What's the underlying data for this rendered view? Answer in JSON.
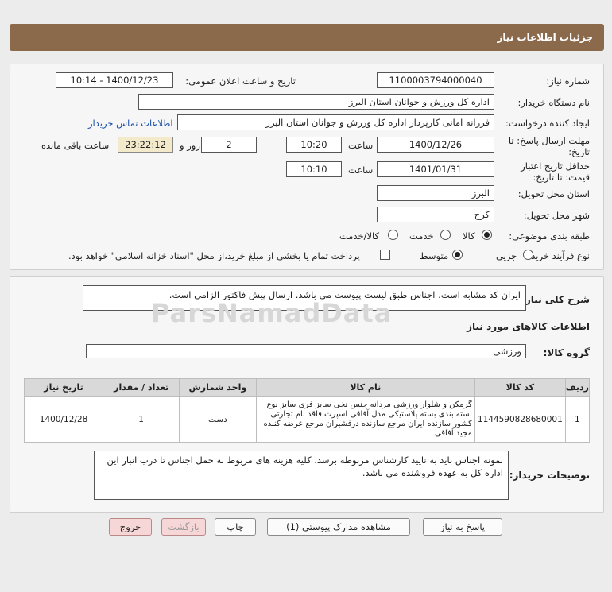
{
  "header": {
    "title": "جزئیات اطلاعات نیاز"
  },
  "form": {
    "need_number_label": "شماره نیاز:",
    "need_number": "1100003794000040",
    "announce_label": "تاریخ و ساعت اعلان عمومی:",
    "announce_value": "1400/12/23 - 10:14",
    "buyer_org_label": "نام دستگاه خریدار:",
    "buyer_org": "اداره کل ورزش و جوانان استان البرز",
    "requester_label": "ایجاد کننده درخواست:",
    "requester": "فرزانه امانی کارپرداز اداره کل ورزش و جوانان استان البرز",
    "contact_link": "اطلاعات تماس خریدار",
    "deadline_label_1": "مهلت ارسال پاسخ: تا",
    "deadline_label_2": "تاریخ:",
    "deadline_date": "1400/12/26",
    "time_label": "ساعت",
    "deadline_time": "10:20",
    "days_value": "2",
    "days_label": "روز و",
    "remaining_time": "23:22:12",
    "remaining_label": "ساعت باقی مانده",
    "validity_label_1": "حداقل تاریخ اعتبار",
    "validity_label_2": "قیمت: تا تاریخ:",
    "validity_date": "1401/01/31",
    "validity_time": "10:10",
    "province_label": "استان محل تحویل:",
    "province": "البرز",
    "city_label": "شهر محل تحویل:",
    "city": "کرج",
    "category_label": "طبقه بندی موضوعی:",
    "category_options": [
      "کالا",
      "خدمت",
      "کالا/خدمت"
    ],
    "process_label": "نوع فرآیند خرید :",
    "process_options": [
      "جزیی",
      "متوسط"
    ],
    "payment_note": "پرداخت تمام یا بخشی از مبلغ خرید،از محل \"اسناد خزانه اسلامی\" خواهد بود."
  },
  "summary": {
    "label": "شرح کلی نیاز:",
    "text": "ایران کد مشابه است. اجناس طبق لیست پیوست می باشد. ارسال پیش فاکتور الزامی است."
  },
  "goods": {
    "section_title": "اطلاعات کالاهای مورد نیاز",
    "group_label": "گروه کالا:",
    "group_value": "ورزشی",
    "columns": [
      "ردیف",
      "کد کالا",
      "نام کالا",
      "واحد شمارش",
      "تعداد / مقدار",
      "تاریخ نیاز"
    ],
    "rows": [
      {
        "index": "1",
        "code": "1144590828680001",
        "name": "گرمکن و شلوار ورزشی مردانه جنس نخی سایز فری سایز نوع بسته بندی بسته پلاستیکی مدل آفاقی اسپرت فاقد نام تجارتی کشور سازنده ایران مرجع سازنده درفشیران مرجع عرضه کننده مجید آفاقی",
        "unit": "دست",
        "qty": "1",
        "date": "1400/12/28"
      }
    ]
  },
  "buyer_notes": {
    "label": "توضیحات خریدار:",
    "text": "نمونه اجناس باید به تایید کارشناس مربوطه برسد. کلیه هزینه های مربوط به حمل اجناس تا درب انبار این اداره کل به عهده فروشنده می باشد."
  },
  "buttons": {
    "reply": "پاسخ به نیاز",
    "attachments": "مشاهده مدارک پیوستی (1)",
    "print": "چاپ",
    "back": "بازگشت",
    "exit": "خروج"
  },
  "watermark": "ParsNamadData",
  "colors": {
    "header": "#8b6a4c",
    "link": "#1a4ea8",
    "timer_bg": "#f2eacb"
  }
}
